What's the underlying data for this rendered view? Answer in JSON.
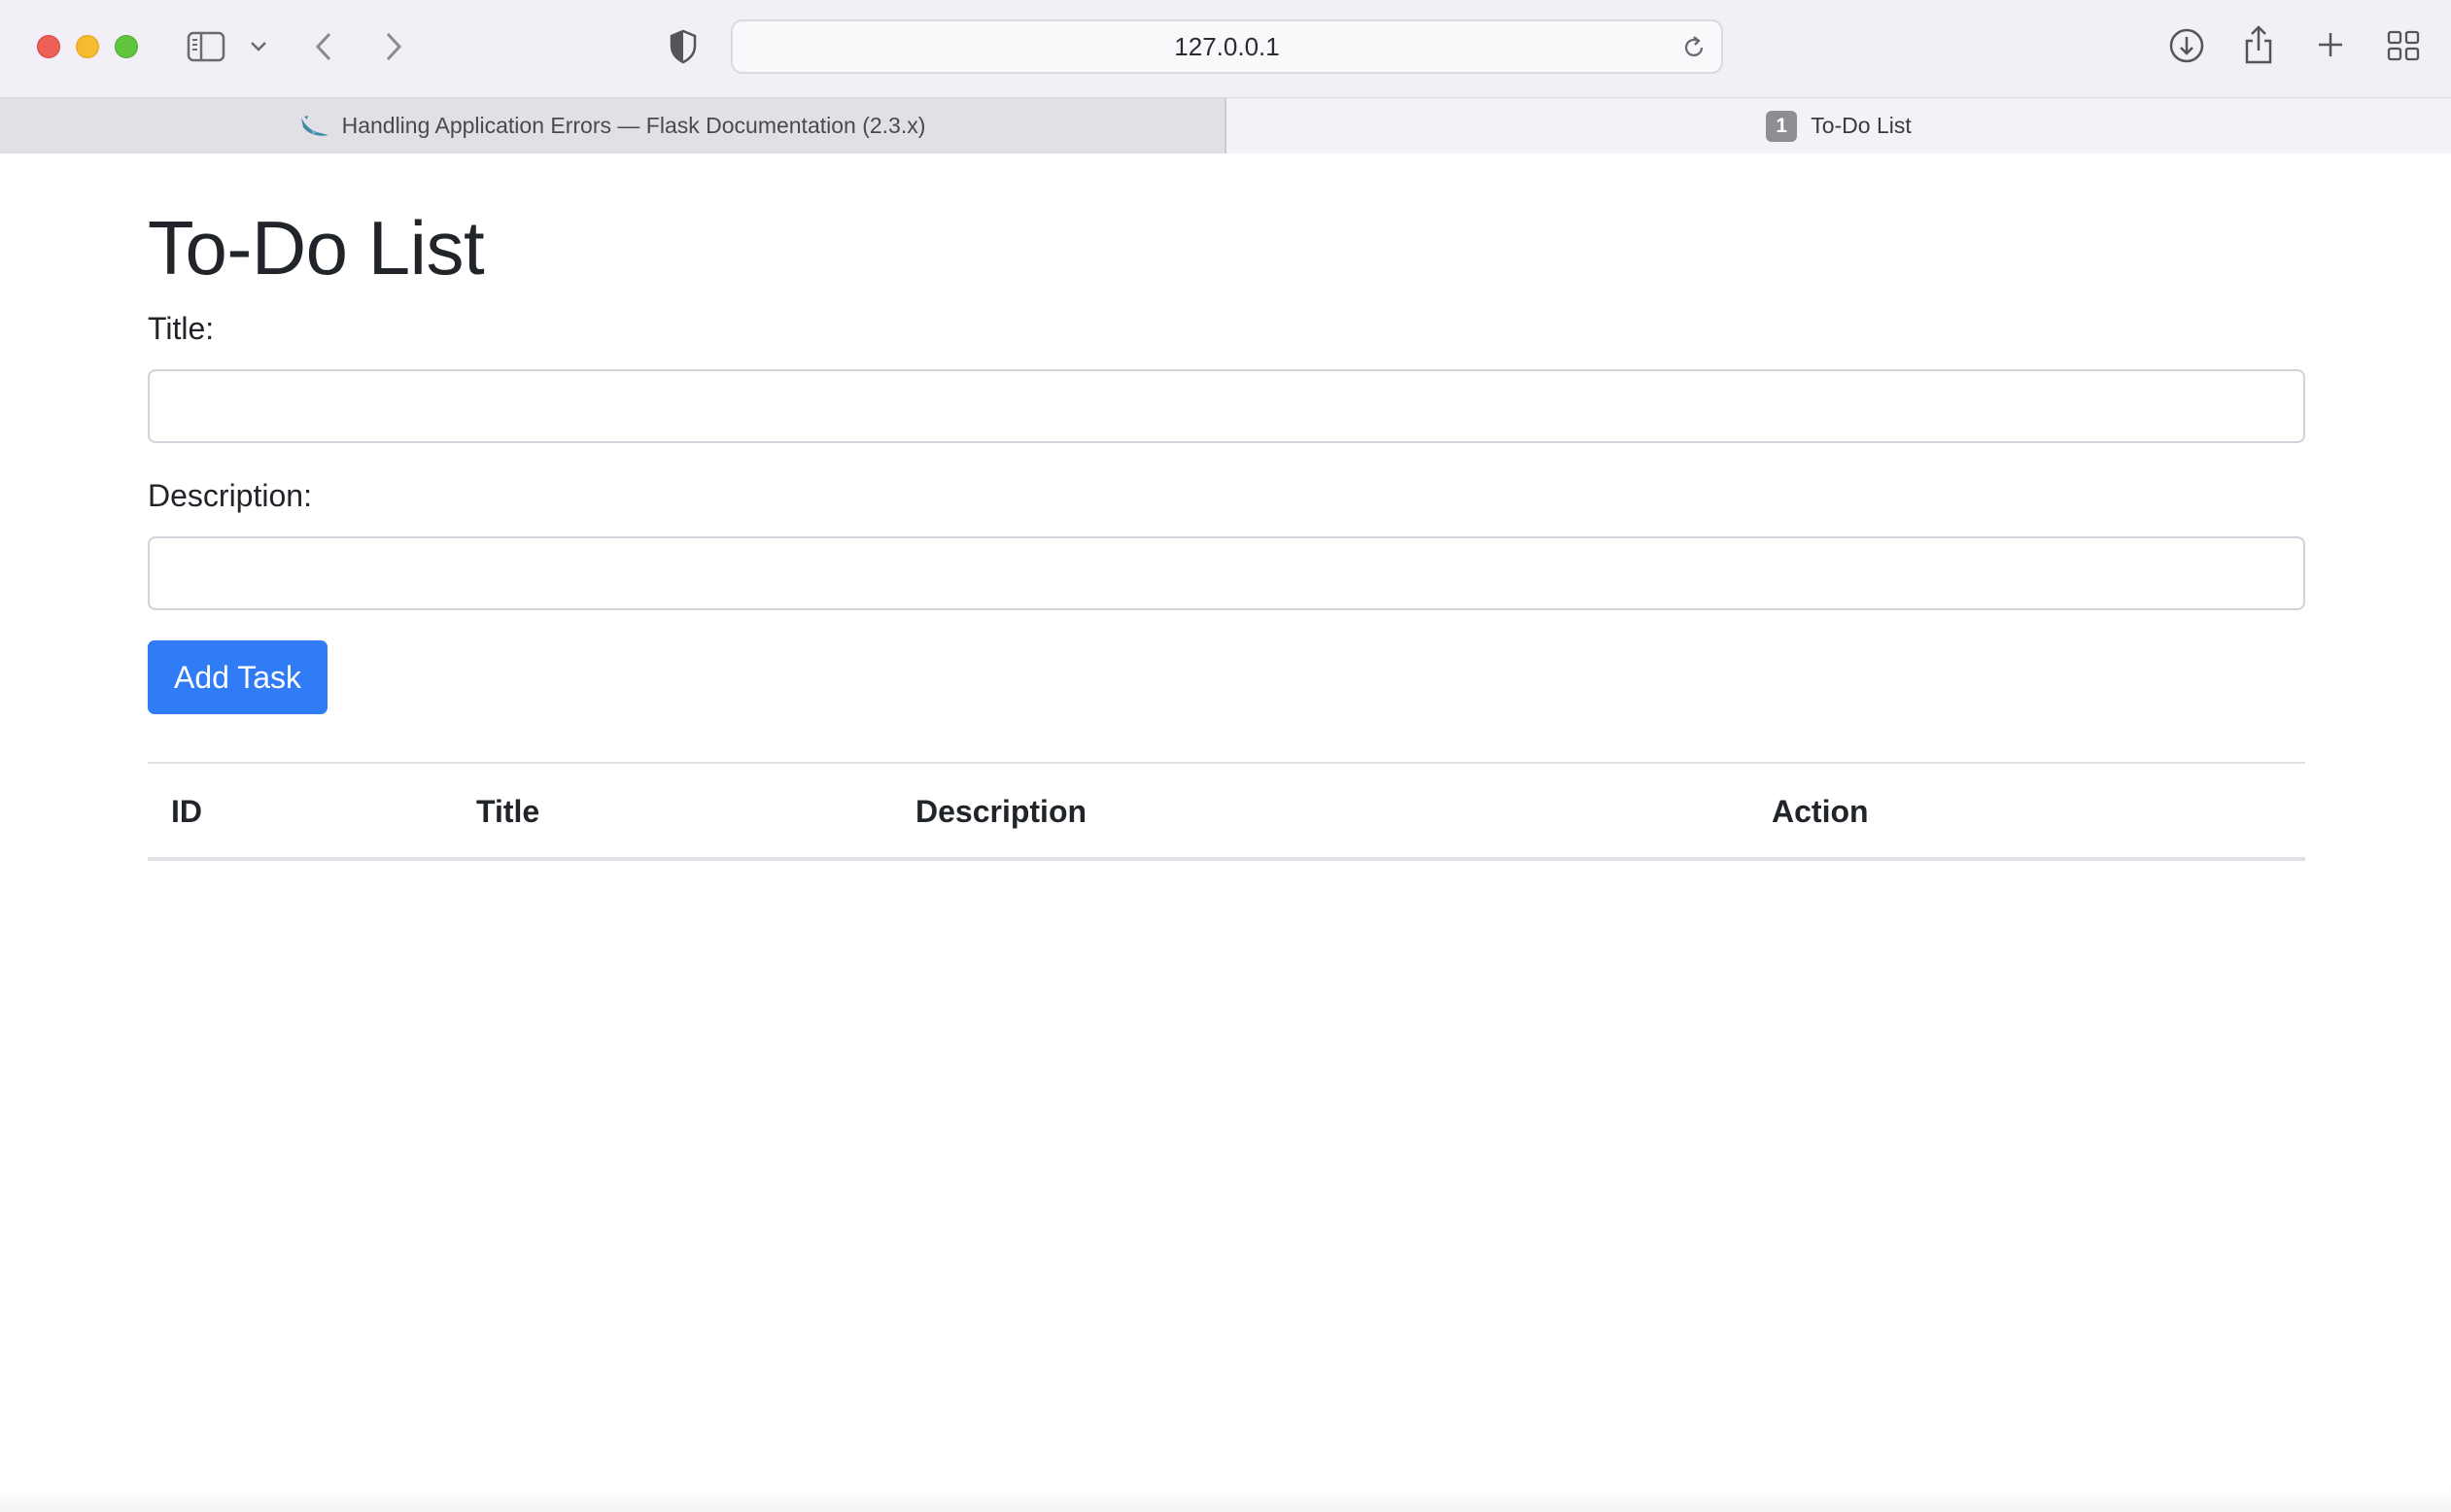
{
  "browser": {
    "url": "127.0.0.1",
    "tabs": [
      {
        "label": "Handling Application Errors — Flask Documentation (2.3.x)",
        "favicon": "flask-icon",
        "active": false
      },
      {
        "label": "To-Do List",
        "badge": "1",
        "active": true
      }
    ],
    "icons": [
      "sidebar-icon",
      "chevron-down-icon",
      "back-icon",
      "forward-icon",
      "shield-icon",
      "reload-icon",
      "download-icon",
      "share-icon",
      "plus-icon",
      "tab-overview-icon"
    ]
  },
  "page": {
    "heading": "To-Do List",
    "form": {
      "title_label": "Title:",
      "title_value": "",
      "description_label": "Description:",
      "description_value": "",
      "submit_label": "Add Task"
    },
    "table": {
      "headers": [
        "ID",
        "Title",
        "Description",
        "Action"
      ],
      "rows": []
    }
  },
  "colors": {
    "primary_button": "#2f7cf6",
    "chrome_background": "#f2eff6"
  }
}
